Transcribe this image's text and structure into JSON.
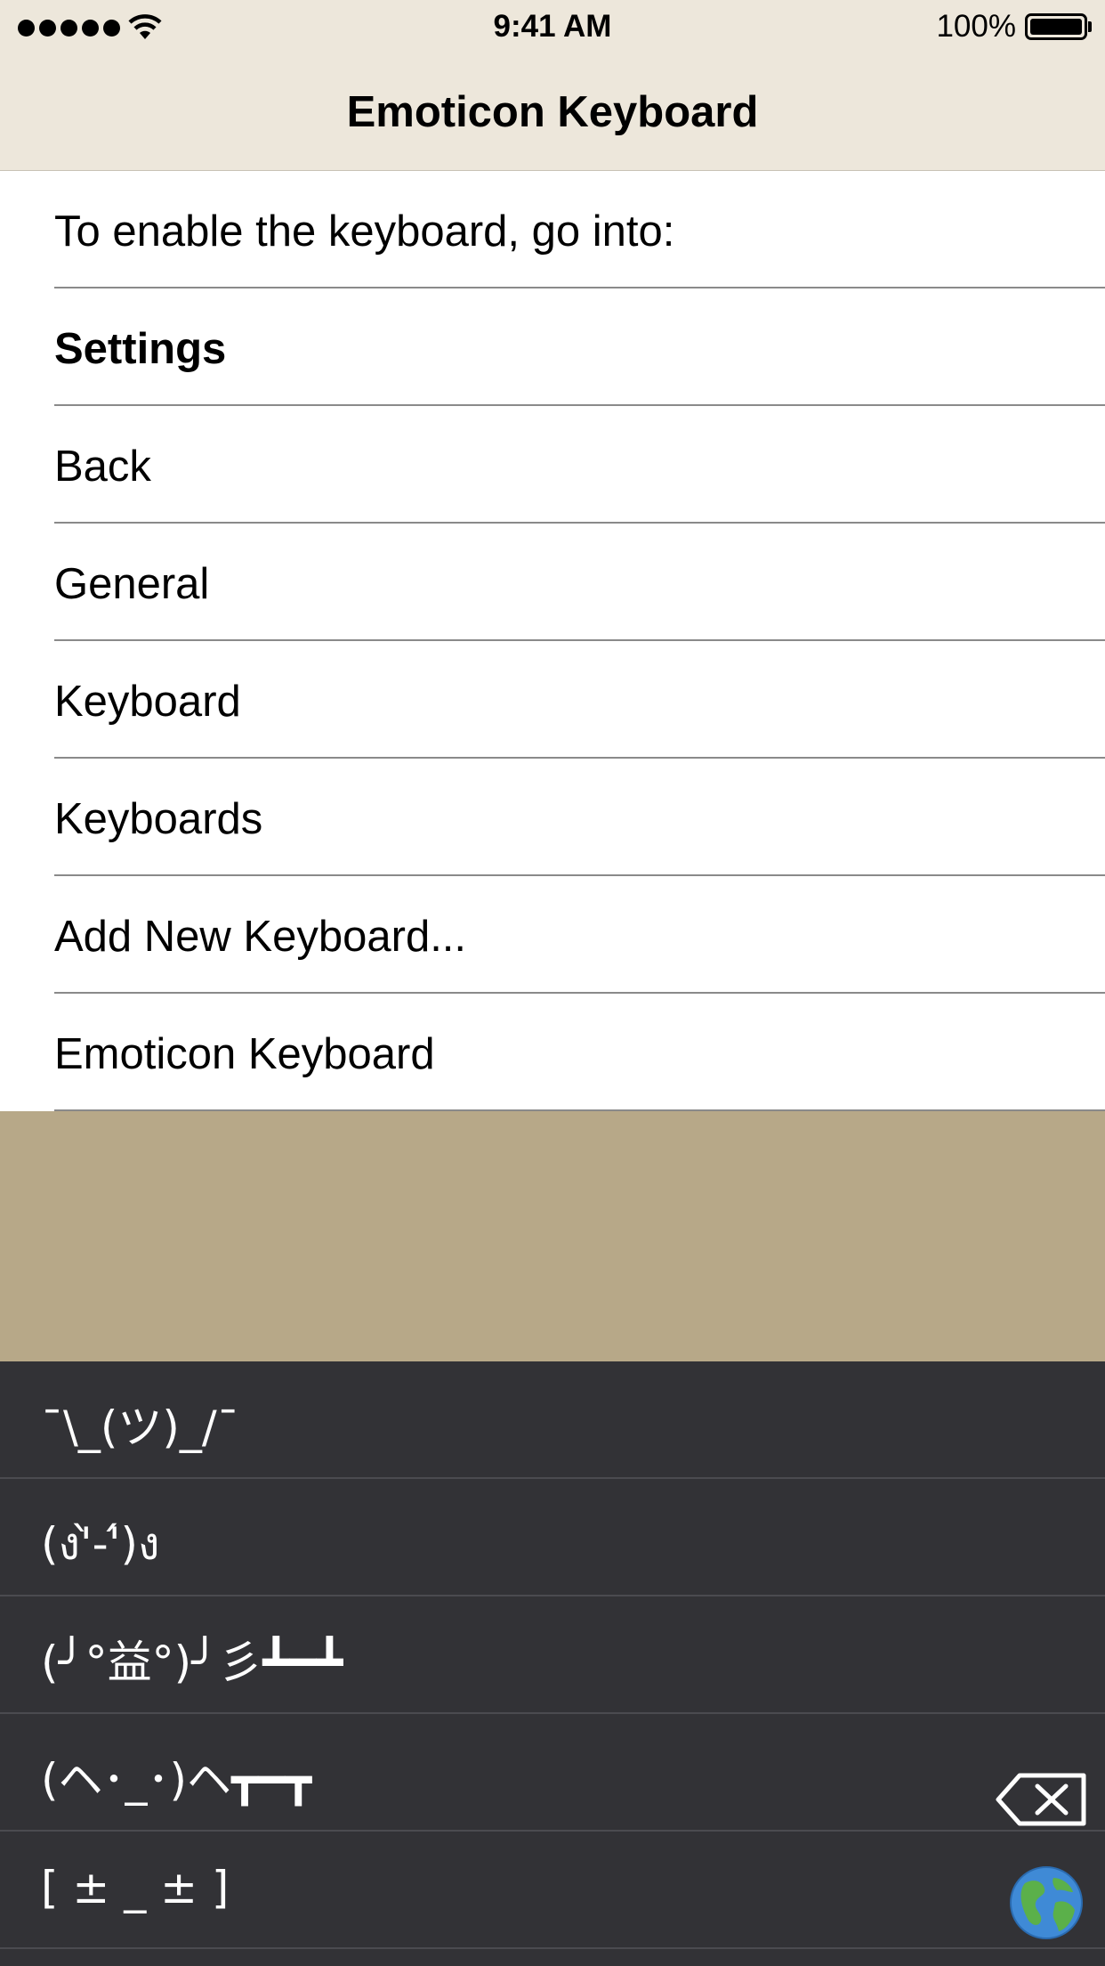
{
  "status_bar": {
    "time": "9:41 AM",
    "battery_percent": "100%",
    "signal_bars": 5,
    "icons": [
      "signal-dots-icon",
      "wifi-icon",
      "battery-icon"
    ]
  },
  "nav": {
    "title": "Emoticon Keyboard"
  },
  "list": {
    "items": [
      {
        "label": "To enable the keyboard, go into:"
      },
      {
        "label": "Settings"
      },
      {
        "label": "Back"
      },
      {
        "label": "General"
      },
      {
        "label": "Keyboard"
      },
      {
        "label": "Keyboards"
      },
      {
        "label": "Add New Keyboard..."
      },
      {
        "label": "Emoticon Keyboard"
      }
    ]
  },
  "keyboard": {
    "emoticons": [
      "¯\\_(ツ)_/¯",
      "(ง'̀-'́)ง",
      "(╯°益°)╯彡┻━┻",
      "(ヘ･_･)ヘ┳━┳",
      "[ ± _ ± ]"
    ],
    "delete_icon": "backspace-icon",
    "globe_icon": "globe-icon"
  },
  "colors": {
    "nav_background": "#ede7db",
    "content_background": "#b7a888",
    "keyboard_background": "#323236"
  }
}
